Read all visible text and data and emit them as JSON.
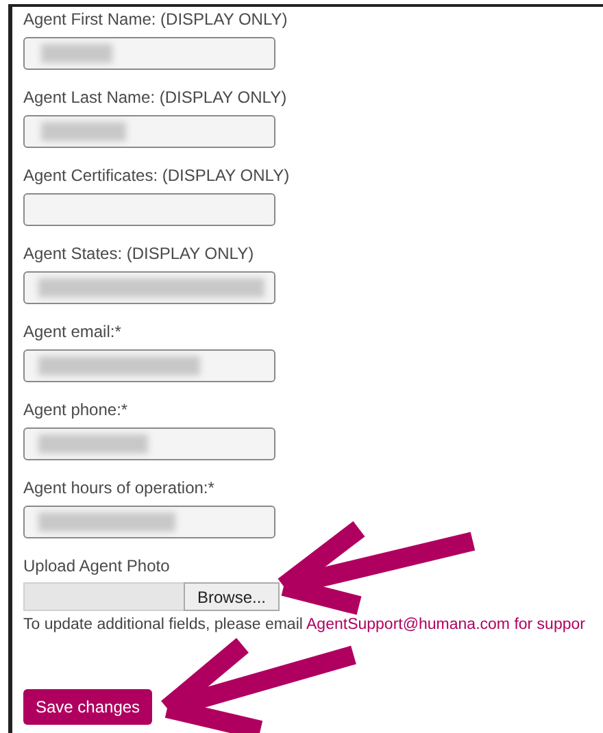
{
  "fields": [
    {
      "label": "Agent First Name: (DISPLAY ONLY)",
      "blurred": true
    },
    {
      "label": "Agent Last Name: (DISPLAY ONLY)",
      "blurred": true
    },
    {
      "label": "Agent Certificates: (DISPLAY ONLY)",
      "blurred": false
    },
    {
      "label": "Agent States: (DISPLAY ONLY)",
      "blurred": true
    },
    {
      "label": "Agent email:*",
      "blurred": true
    },
    {
      "label": "Agent phone:*",
      "blurred": true
    },
    {
      "label": "Agent hours of operation:*",
      "blurred": true
    }
  ],
  "upload": {
    "label": "Upload Agent Photo",
    "button": "Browse..."
  },
  "note": {
    "text": "To update additional fields, please email ",
    "link": "AgentSupport@humana.com for suppor"
  },
  "save_button": "Save changes",
  "annotations": [
    {
      "kind": "arrow"
    },
    {
      "kind": "arrow"
    }
  ]
}
